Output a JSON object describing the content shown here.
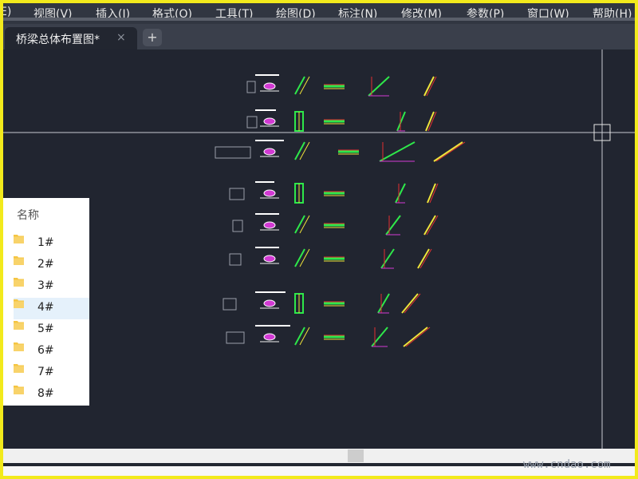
{
  "menubar": {
    "items": [
      {
        "label": "E)"
      },
      {
        "label": "视图(V)"
      },
      {
        "label": "插入(I)"
      },
      {
        "label": "格式(O)"
      },
      {
        "label": "工具(T)"
      },
      {
        "label": "绘图(D)"
      },
      {
        "label": "标注(N)"
      },
      {
        "label": "修改(M)"
      },
      {
        "label": "参数(P)"
      },
      {
        "label": "窗口(W)"
      },
      {
        "label": "帮助(H)"
      }
    ]
  },
  "tabs": {
    "document_title": "桥梁总体布置图*",
    "close_glyph": "×",
    "new_tab_glyph": "+"
  },
  "file_panel": {
    "header": "名称",
    "selected_index": 3,
    "folders": [
      {
        "label": "1#"
      },
      {
        "label": "2#"
      },
      {
        "label": "3#"
      },
      {
        "label": "4#"
      },
      {
        "label": "5#"
      },
      {
        "label": "6#"
      },
      {
        "label": "7#"
      },
      {
        "label": "8#"
      }
    ]
  },
  "watermark": "www.cndao.com",
  "colors": {
    "outer_border": "#f2ea1c",
    "canvas_bg": "#212530",
    "selected_row": "#e5f1fb",
    "folder": "#f5c542"
  }
}
